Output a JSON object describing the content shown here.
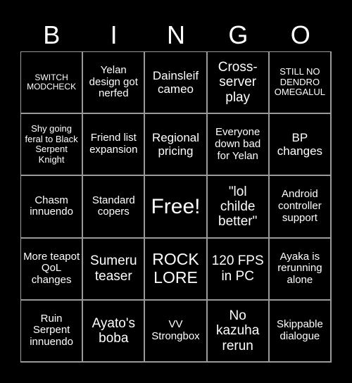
{
  "header": {
    "letters": [
      "B",
      "I",
      "N",
      "G",
      "O"
    ]
  },
  "card": {
    "rows": [
      [
        "SWITCH MODCHECK",
        "Yelan design got nerfed",
        "Dainsleif cameo",
        "Cross-server play",
        "STILL NO DENDRO OMEGALUL"
      ],
      [
        "Shy going feral to Black Serpent Knight",
        "Friend list expansion",
        "Regional pricing",
        "Everyone down bad for Yelan",
        "BP changes"
      ],
      [
        "Chasm innuendo",
        "Standard copers",
        "Free!",
        "\"lol childe better\"",
        "Android controller support"
      ],
      [
        "More teapot QoL changes",
        "Sumeru teaser",
        "ROCK LORE",
        "120 FPS in PC",
        "Ayaka is rerunning alone"
      ],
      [
        "Ruin Serpent innuendo",
        "Ayato's boba",
        "VV Strongbox",
        "No kazuha rerun",
        "Skippable dialogue"
      ]
    ]
  },
  "colors": {
    "background": "#000000",
    "text": "#ffffff",
    "grid_line": "#9a9a9a"
  }
}
